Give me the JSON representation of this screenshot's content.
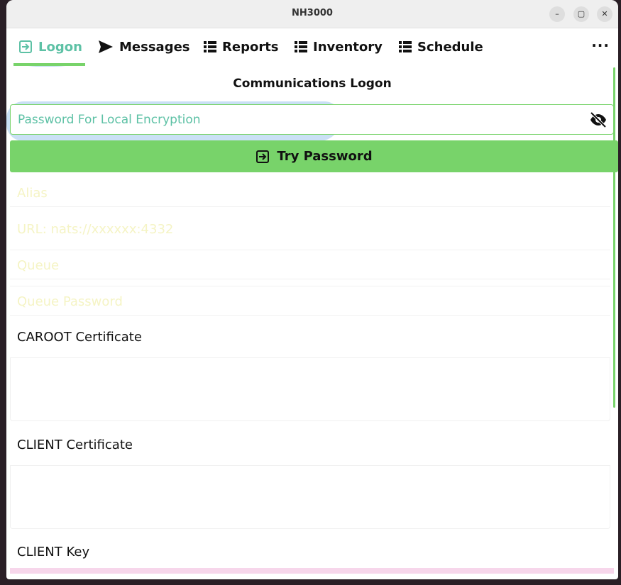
{
  "window": {
    "title": "NH3000"
  },
  "window_controls": {
    "minimize": "–",
    "maximize": "▢",
    "close": "✕"
  },
  "tabs": [
    {
      "label": "Logon",
      "icon": "login-icon",
      "active": true
    },
    {
      "label": "Messages",
      "icon": "send-icon",
      "active": false
    },
    {
      "label": "Reports",
      "icon": "list-icon",
      "active": false
    },
    {
      "label": "Inventory",
      "icon": "list-icon",
      "active": false
    },
    {
      "label": "Schedule",
      "icon": "list-icon",
      "active": false
    }
  ],
  "more_menu": "···",
  "page": {
    "title": "Communications Logon",
    "password_placeholder": "Password For Local Encryption",
    "password_value": "",
    "try_button": "Try Password",
    "fields": {
      "alias": "Alias",
      "url": "URL: nats://xxxxxx:4332",
      "queue": "Queue",
      "queue_password": "Queue Password"
    },
    "certs": {
      "caroot": "CAROOT Certificate",
      "client_cert": "CLIENT Certificate",
      "client_key": "CLIENT Key"
    }
  },
  "colors": {
    "accent_green": "#78d36a",
    "active_teal": "#5dc1a5",
    "placeholder_yellow": "#f5f4c5",
    "highlight_blue": "#5aa0e1"
  }
}
